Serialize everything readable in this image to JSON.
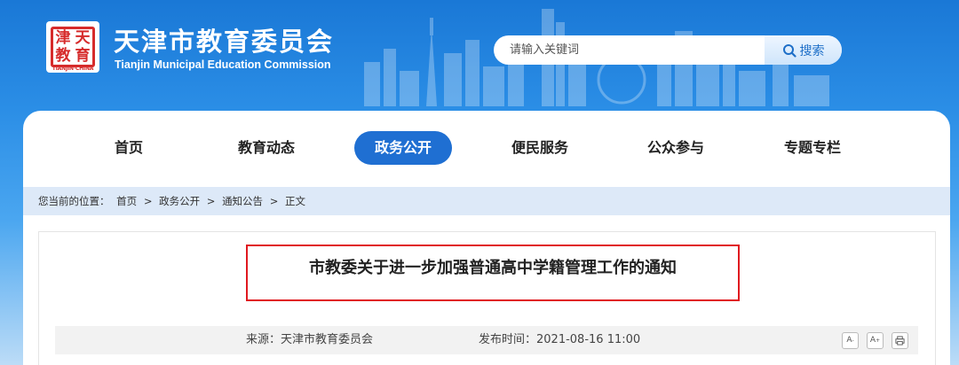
{
  "header": {
    "logo_chars": [
      "天",
      "津",
      "教",
      "育"
    ],
    "logo_caption": "TIANJIN·CHINA",
    "title": "天津市教育委员会",
    "subtitle": "Tianjin Municipal Education Commission"
  },
  "search": {
    "placeholder": "请输入关键词",
    "button_label": "搜索",
    "icon": "search-icon"
  },
  "nav": {
    "items": [
      {
        "label": "首页",
        "active": false
      },
      {
        "label": "教育动态",
        "active": false
      },
      {
        "label": "政务公开",
        "active": true
      },
      {
        "label": "便民服务",
        "active": false
      },
      {
        "label": "公众参与",
        "active": false
      },
      {
        "label": "专题专栏",
        "active": false
      }
    ]
  },
  "breadcrumb": {
    "prefix": "您当前的位置：",
    "items": [
      "首页",
      "政务公开",
      "通知公告",
      "正文"
    ],
    "separator": ">"
  },
  "article": {
    "title": "市教委关于进一步加强普通高中学籍管理工作的通知",
    "source_label": "来源：",
    "source_value": "天津市教育委员会",
    "time_label": "发布时间：",
    "time_value": "2021-08-16 11:00"
  },
  "tools": {
    "font_smaller": "A",
    "font_smaller_mark": "-",
    "font_larger": "A",
    "font_larger_mark": "+",
    "print_icon": "printer-icon"
  },
  "colors": {
    "header_blue": "#1f7fd8",
    "nav_active": "#1f6fd2",
    "breadcrumb_bg": "#dde9f8",
    "highlight_red": "#e0191f"
  }
}
